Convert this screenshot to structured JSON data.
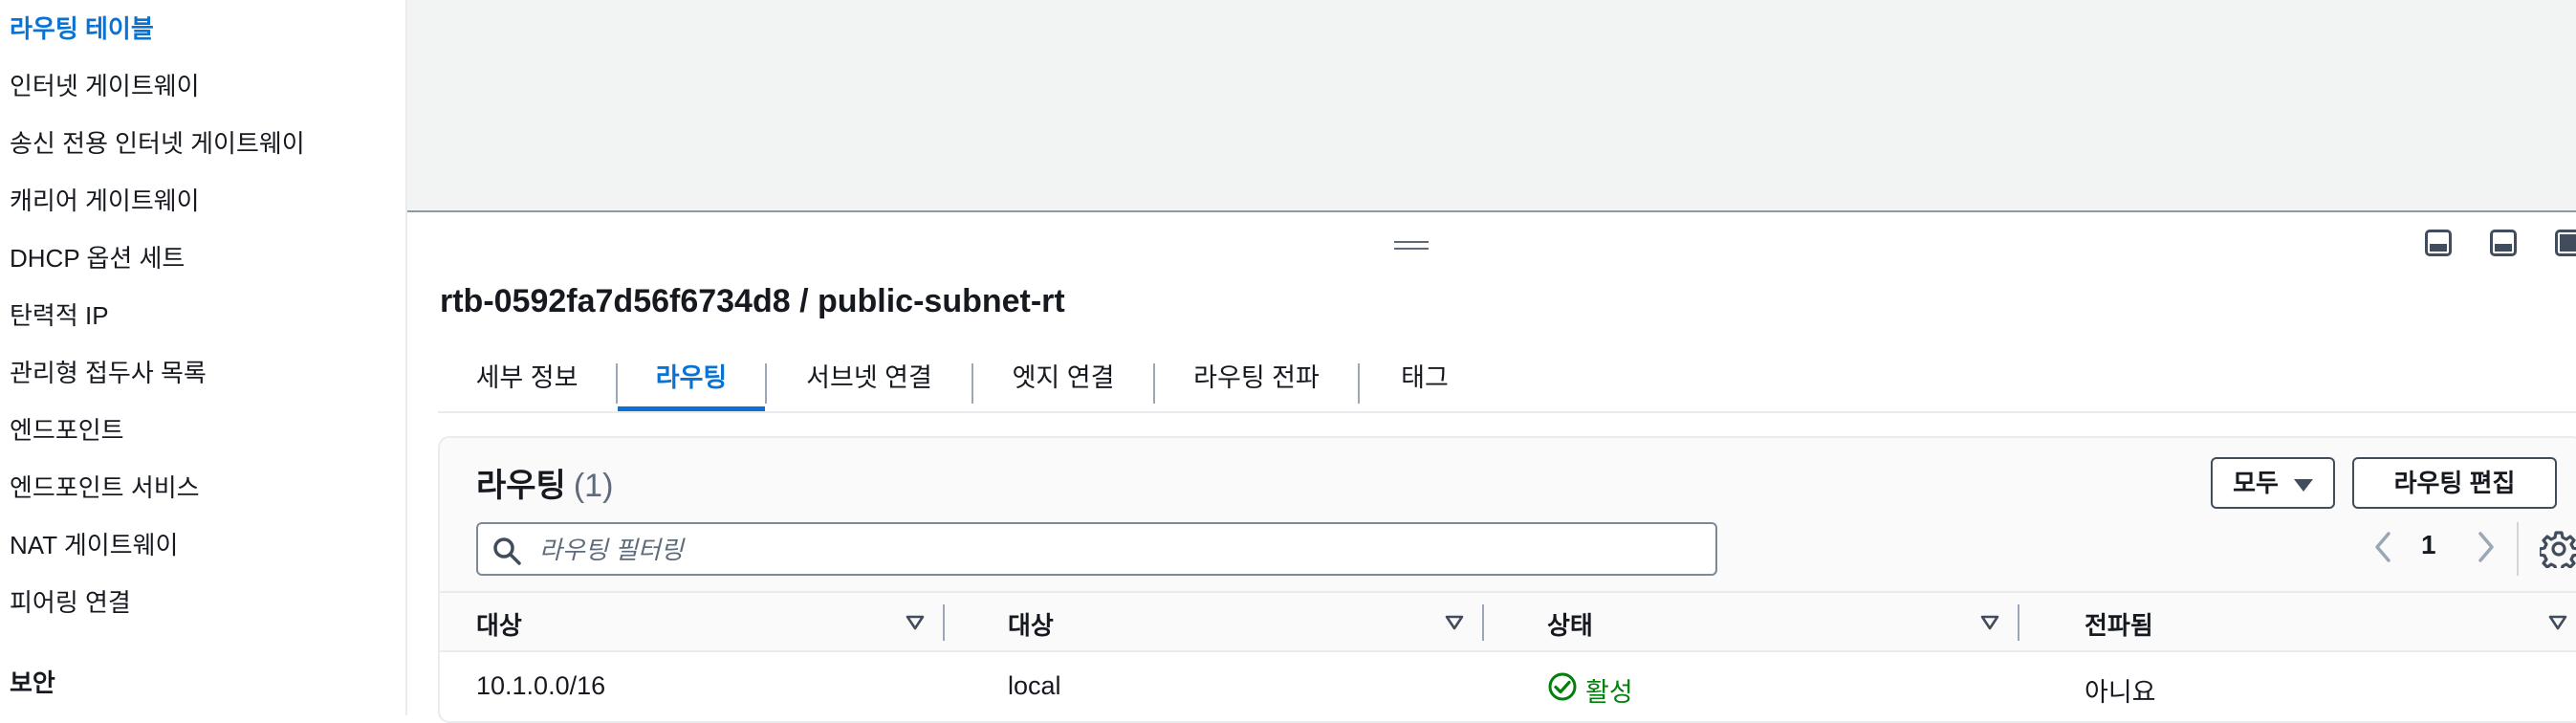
{
  "sidebar": {
    "items": [
      {
        "label": "라우팅 테이블",
        "active": true
      },
      {
        "label": "인터넷 게이트웨이"
      },
      {
        "label": "송신 전용 인터넷 게이트웨이"
      },
      {
        "label": "캐리어 게이트웨이"
      },
      {
        "label": "DHCP 옵션 세트"
      },
      {
        "label": "탄력적 IP"
      },
      {
        "label": "관리형 접두사 목록"
      },
      {
        "label": "엔드포인트"
      },
      {
        "label": "엔드포인트 서비스"
      },
      {
        "label": "NAT 게이트웨이"
      },
      {
        "label": "피어링 연결"
      }
    ],
    "section_security": "보안"
  },
  "detail": {
    "title": "rtb-0592fa7d56f6734d8 / public-subnet-rt",
    "tabs": [
      {
        "label": "세부 정보"
      },
      {
        "label": "라우팅",
        "active": true
      },
      {
        "label": "서브넷 연결"
      },
      {
        "label": "엣지 연결"
      },
      {
        "label": "라우팅 전파"
      },
      {
        "label": "태그"
      }
    ]
  },
  "routes": {
    "title": "라우팅",
    "count": "(1)",
    "filter_select_label": "모두",
    "edit_button_label": "라우팅 편집",
    "search_placeholder": "라우팅 필터링",
    "current_page": "1",
    "columns": [
      "대상",
      "대상",
      "상태",
      "전파됨"
    ],
    "rows": [
      {
        "destination": "10.1.0.0/16",
        "target": "local",
        "status": "활성",
        "propagated": "아니요"
      }
    ]
  },
  "colors": {
    "accent": "#0972d3",
    "success": "#037f0c",
    "text": "#16191f"
  },
  "icons": [
    "search-icon",
    "gear-icon",
    "chevron-left-icon",
    "chevron-right-icon",
    "sort-caret-icon",
    "check-circle-icon",
    "panel-position-icon",
    "drag-handle-icon"
  ]
}
